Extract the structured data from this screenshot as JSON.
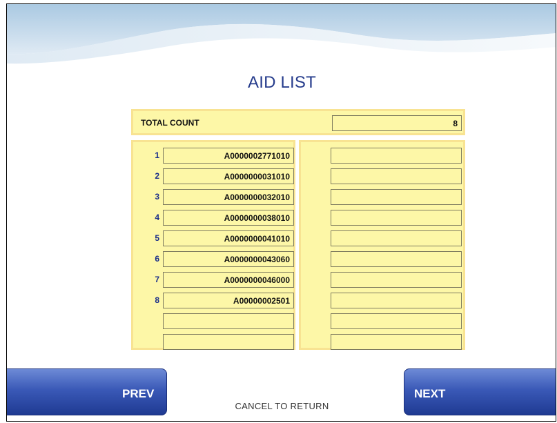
{
  "screen": {
    "title": "AID LIST",
    "total_label": "TOTAL COUNT",
    "total_value": "8",
    "left_rows": [
      {
        "index": "1",
        "aid": "A0000002771010"
      },
      {
        "index": "2",
        "aid": "A0000000031010"
      },
      {
        "index": "3",
        "aid": "A0000000032010"
      },
      {
        "index": "4",
        "aid": "A0000000038010"
      },
      {
        "index": "5",
        "aid": "A0000000041010"
      },
      {
        "index": "6",
        "aid": "A0000000043060"
      },
      {
        "index": "7",
        "aid": "A0000000046000"
      },
      {
        "index": "8",
        "aid": "A00000002501"
      },
      {
        "index": "",
        "aid": ""
      },
      {
        "index": "",
        "aid": ""
      }
    ],
    "right_rows": [
      "",
      "",
      "",
      "",
      "",
      "",
      "",
      "",
      "",
      ""
    ]
  },
  "buttons": {
    "prev_label": "PREV",
    "next_label": "NEXT"
  },
  "footer": {
    "cancel_text": "CANCEL TO RETURN"
  },
  "colors": {
    "title": "#263c8c",
    "panel_fill": "#fdf7a7",
    "panel_border": "#f8e392",
    "button_blue": "#3a59b7"
  }
}
